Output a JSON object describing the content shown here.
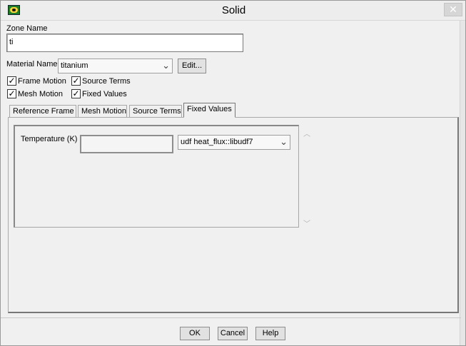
{
  "window": {
    "title": "Solid",
    "close_glyph": "✕"
  },
  "zone": {
    "label": "Zone Name",
    "value": "ti"
  },
  "material": {
    "label": "Material Name",
    "selected": "titanium",
    "edit_label": "Edit..."
  },
  "checkboxes": [
    {
      "label": "Frame Motion",
      "checked": true
    },
    {
      "label": "Source Terms",
      "checked": true
    },
    {
      "label": "Mesh Motion",
      "checked": true
    },
    {
      "label": "Fixed Values",
      "checked": true
    }
  ],
  "tabs": [
    {
      "label": "Reference Frame",
      "active": false
    },
    {
      "label": "Mesh Motion",
      "active": false
    },
    {
      "label": "Source Terms",
      "active": false
    },
    {
      "label": "Fixed Values",
      "active": true
    }
  ],
  "fixed_values": {
    "temperature_label": "Temperature (K)",
    "temperature_value": "",
    "udf_selected": "udf heat_flux::libudf7"
  },
  "buttons": {
    "ok": "OK",
    "cancel": "Cancel",
    "help": "Help"
  },
  "icons": {
    "app": "fluent-app-icon",
    "dropdown": "chevron-down-icon",
    "scroll_up": "scroll-up-icon",
    "scroll_down": "scroll-down-icon"
  }
}
